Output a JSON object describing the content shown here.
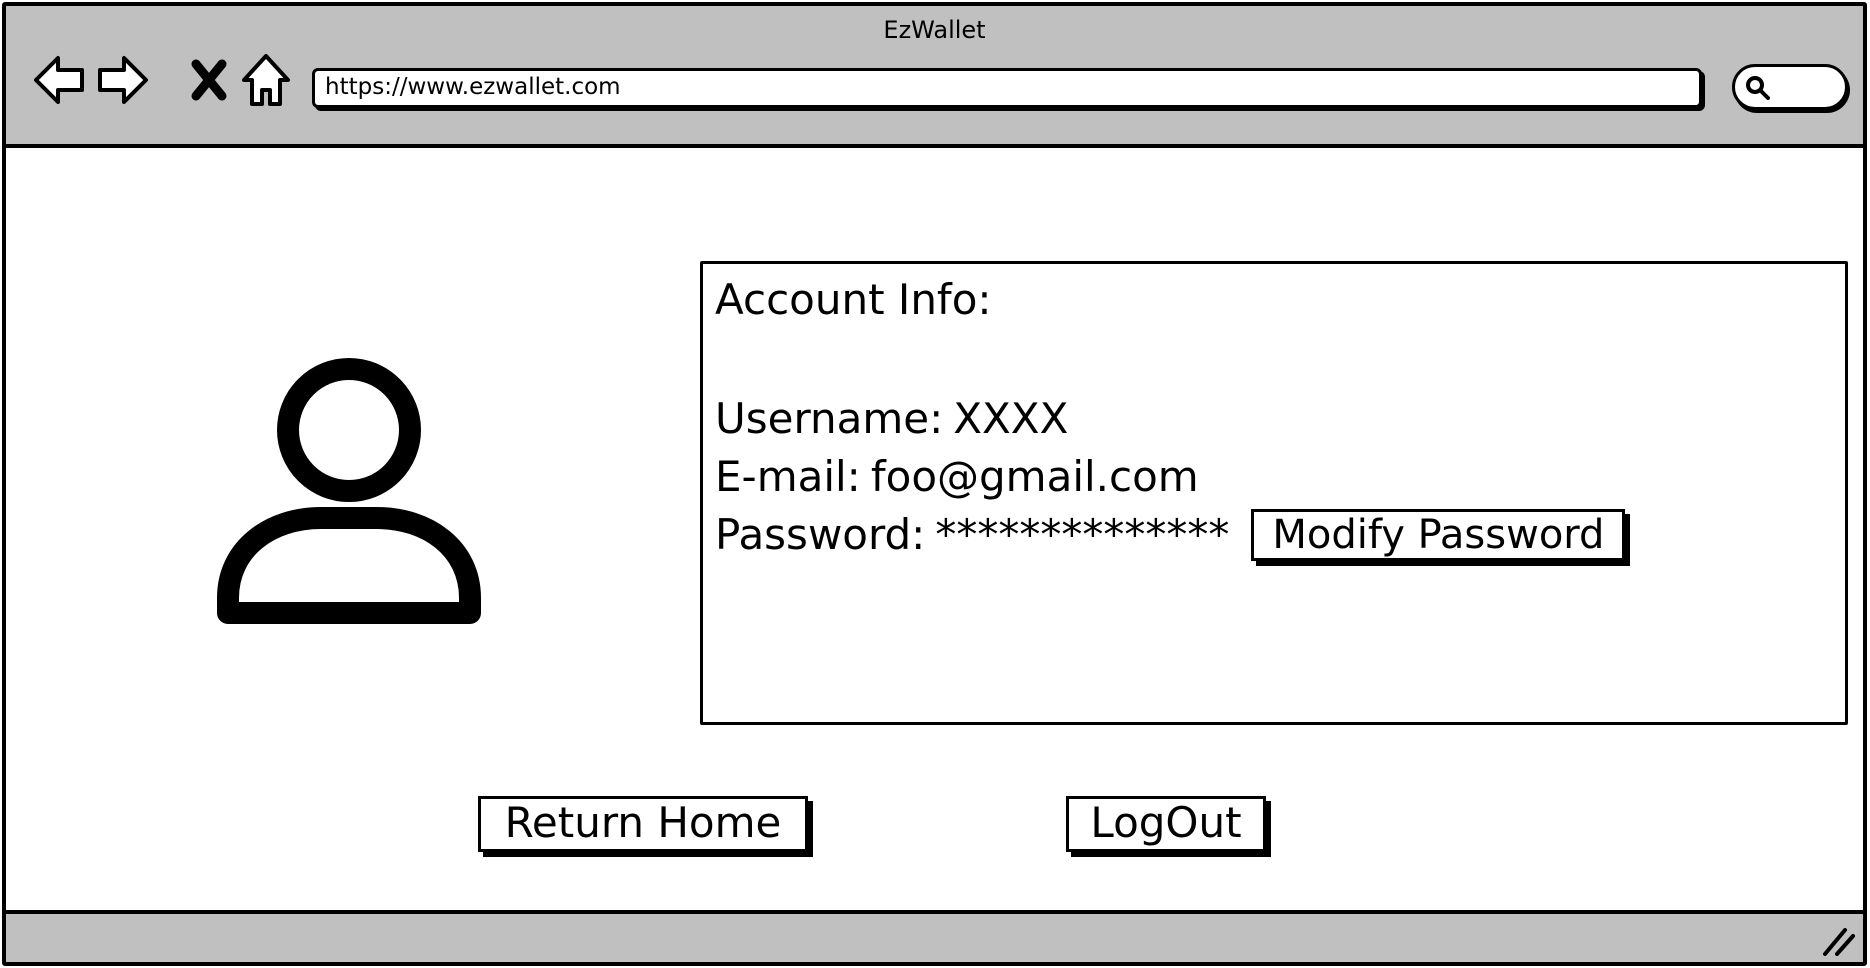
{
  "window": {
    "title": "EzWallet"
  },
  "toolbar": {
    "back_icon": "back-arrow-icon",
    "forward_icon": "forward-arrow-icon",
    "stop_icon": "close-icon",
    "home_icon": "home-icon",
    "url": "https://www.ezwallet.com",
    "search_icon": "search-icon"
  },
  "profile": {
    "avatar_icon": "user-avatar-icon"
  },
  "account": {
    "heading": "Account Info:",
    "username_label": "Username:",
    "username_value": "XXXX",
    "email_label": "E-mail:",
    "email_value": "foo@gmail.com",
    "password_label": "Password:",
    "password_value": "**************",
    "modify_password_label": "Modify Password"
  },
  "actions": {
    "return_home_label": "Return Home",
    "logout_label": "LogOut"
  },
  "statusbar": {
    "resize_icon": "resize-grip-icon"
  },
  "colors": {
    "chrome": "#c0c0c0",
    "ink": "#000000",
    "background": "#ffffff"
  }
}
